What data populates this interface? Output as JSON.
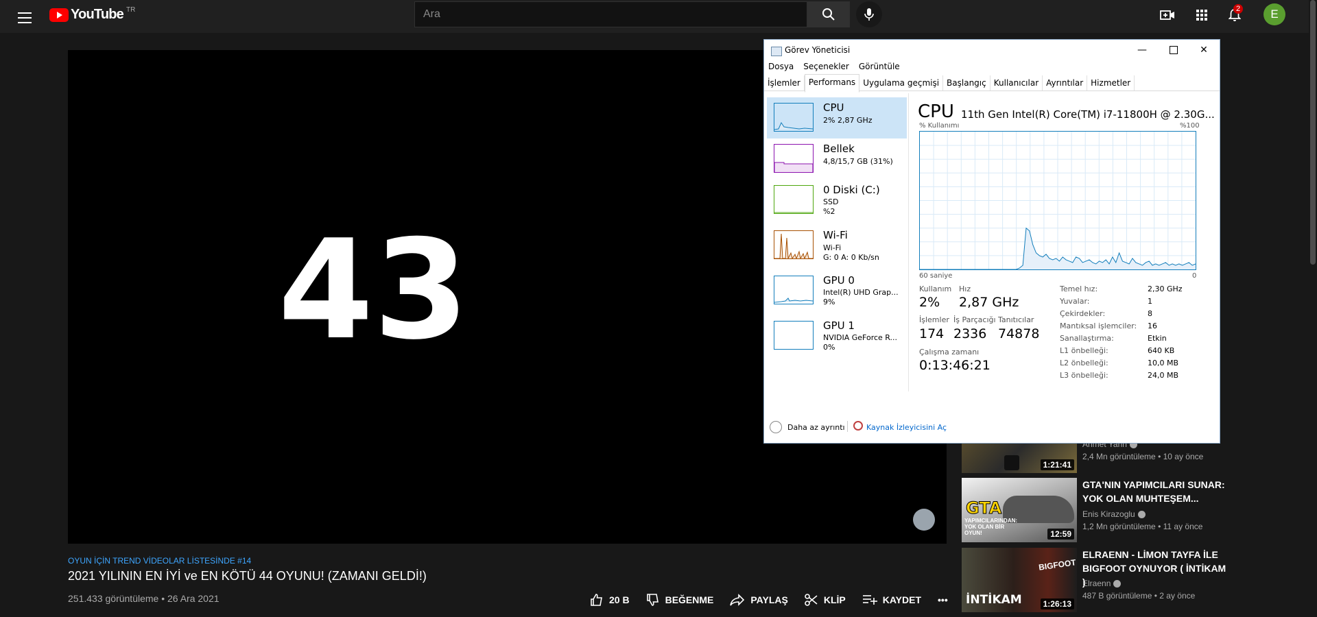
{
  "youtube": {
    "logo_text": "YouTube",
    "region": "TR",
    "search_placeholder": "Ara",
    "notification_count": "2",
    "avatar_letter": "E"
  },
  "player": {
    "frame_number": "43"
  },
  "video": {
    "hashtag": "OYUN İÇİN TREND VİDEOLAR LİSTESİNDE #14",
    "title": "2021 YILININ EN İYİ ve EN KÖTÜ 44 OYUNU! (ZAMANI GELDİ!)",
    "meta": "251.433 görüntüleme • 26 Ara 2021",
    "likes": "20 B",
    "dislike_label": "BEĞENME",
    "share_label": "PAYLAŞ",
    "clip_label": "KLİP",
    "save_label": "KAYDET",
    "more": "•••"
  },
  "recommendations": [
    {
      "title": "",
      "channel": "Ahmet Yahn",
      "stats": "2,4 Mn görüntüleme • 10 ay önce",
      "duration": "1:21:41"
    },
    {
      "title": "GTA'NIN YAPIMCILARI SUNAR: YOK OLAN MUHTEŞEM...",
      "channel": "Enis Kirazoglu",
      "stats": "1,2 Mn görüntüleme • 11 ay önce",
      "duration": "12:59",
      "thumb_text": "GTA",
      "thumb_sub": "YAPIMCILARINDAN: YOK OLAN BİR OYUN!"
    },
    {
      "title": "ELRAENN - LİMON TAYFA İLE BIGFOOT OYNUYOR ( İNTİKAM )",
      "channel": "Elraenn",
      "stats": "487 B görüntüleme • 2 ay önce",
      "duration": "1:26:13",
      "thumb_text": "İNTİKAM",
      "thumb_sub": "BIGFOOT"
    }
  ],
  "task_manager": {
    "title": "Görev Yöneticisi",
    "menu": [
      "Dosya",
      "Seçenekler",
      "Görüntüle"
    ],
    "tabs": [
      "İşlemler",
      "Performans",
      "Uygulama geçmişi",
      "Başlangıç",
      "Kullanıcılar",
      "Ayrıntılar",
      "Hizmetler"
    ],
    "active_tab": "Performans",
    "resources": [
      {
        "name": "CPU",
        "sub1": "2% 2,87 GHz",
        "sub2": "",
        "color": "#117dbb"
      },
      {
        "name": "Bellek",
        "sub1": "4,8/15,7 GB (31%)",
        "sub2": "",
        "color": "#8b12ae"
      },
      {
        "name": "0 Diski (C:)",
        "sub1": "SSD",
        "sub2": "%2",
        "color": "#4da60c"
      },
      {
        "name": "Wi-Fi",
        "sub1": "Wi-Fi",
        "sub2": "G: 0 A: 0 Kb/sn",
        "color": "#a74f01"
      },
      {
        "name": "GPU 0",
        "sub1": "Intel(R) UHD Grap...",
        "sub2": "9%",
        "color": "#117dbb"
      },
      {
        "name": "GPU 1",
        "sub1": "NVIDIA GeForce R...",
        "sub2": "0%",
        "color": "#117dbb"
      }
    ],
    "cpu": {
      "heading": "CPU",
      "model": "11th Gen Intel(R) Core(TM) i7-11800H @ 2.30G...",
      "usage_label": "% Kullanımı",
      "max_label": "%100",
      "time_label": "60 saniye",
      "zero_label": "0",
      "usage_history": [
        0,
        0,
        0,
        0,
        0,
        0,
        0,
        0,
        0,
        0,
        0,
        0,
        0,
        0,
        0,
        0,
        0,
        0,
        0,
        0,
        0,
        0,
        0,
        0,
        0,
        0,
        0,
        0,
        0,
        0,
        1,
        3,
        30,
        28,
        18,
        12,
        10,
        9,
        11,
        8,
        7,
        8,
        6,
        9,
        7,
        6,
        5,
        9,
        8,
        5,
        6,
        7,
        5,
        4,
        6,
        5,
        7,
        4,
        9,
        5,
        12,
        6,
        5,
        4,
        8,
        5,
        4,
        3,
        5,
        6,
        3,
        4,
        3,
        4,
        5,
        3,
        4,
        3,
        4,
        3,
        4,
        5,
        3,
        4
      ],
      "stats": [
        {
          "label": "Kullanım",
          "value": "2%"
        },
        {
          "label": "Hız",
          "value": "2,87 GHz"
        },
        {
          "label": "İşlemler",
          "value": "174"
        },
        {
          "label": "İş Parçacığı",
          "value": "2336"
        },
        {
          "label": "Tanıtıcılar",
          "value": "74878"
        },
        {
          "label": "Çalışma zamanı",
          "value": "0:13:46:21"
        }
      ],
      "specs": [
        {
          "label": "Temel hız:",
          "value": "2,30 GHz"
        },
        {
          "label": "Yuvalar:",
          "value": "1"
        },
        {
          "label": "Çekirdekler:",
          "value": "8"
        },
        {
          "label": "Mantıksal işlemciler:",
          "value": "16"
        },
        {
          "label": "Sanallaştırma:",
          "value": "Etkin"
        },
        {
          "label": "L1 önbelleği:",
          "value": "640 KB"
        },
        {
          "label": "L2 önbelleği:",
          "value": "10,0 MB"
        },
        {
          "label": "L3 önbelleği:",
          "value": "24,0 MB"
        }
      ]
    },
    "fewer_details": "Daha az ayrıntı",
    "resource_monitor": "Kaynak İzleyicisini Aç"
  }
}
